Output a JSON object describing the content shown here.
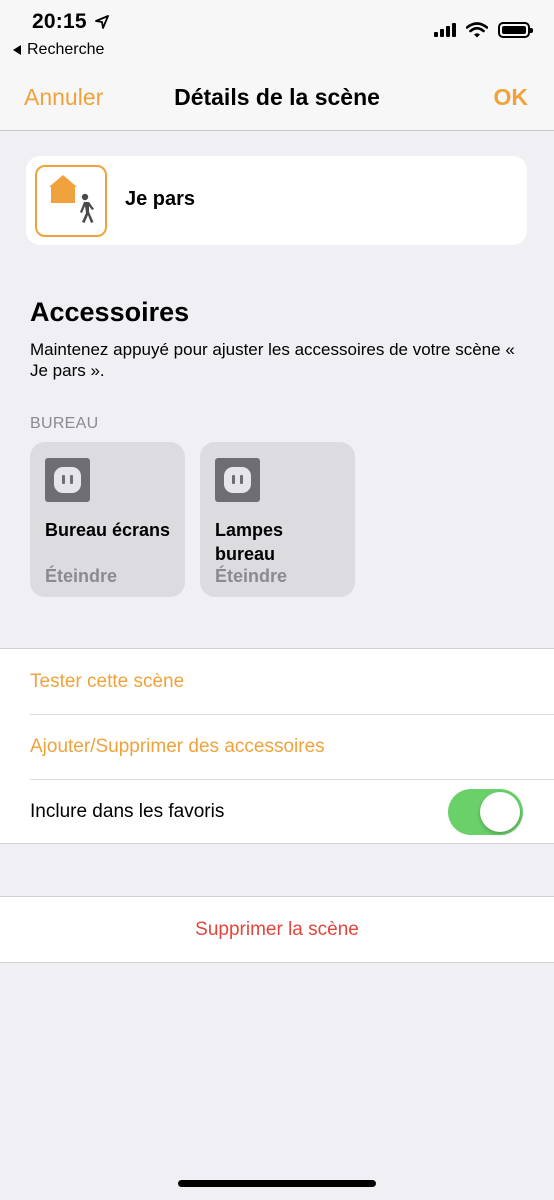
{
  "status": {
    "time": "20:15",
    "back_app": "Recherche"
  },
  "nav": {
    "cancel": "Annuler",
    "title": "Détails de la scène",
    "ok": "OK"
  },
  "scene": {
    "name": "Je pars"
  },
  "accessories": {
    "title": "Accessoires",
    "description": "Maintenez appuyé pour ajuster les accessoires de votre scène « Je pars ».",
    "room": "BUREAU",
    "tiles": [
      {
        "name": "Bureau écrans",
        "status": "Éteindre"
      },
      {
        "name": "Lampes bureau",
        "status": "Éteindre"
      }
    ]
  },
  "actions": {
    "test": "Tester cette scène",
    "edit": "Ajouter/Supprimer des accessoires",
    "favorites": "Inclure dans les favoris",
    "favorites_on": true,
    "delete": "Supprimer la scène"
  },
  "colors": {
    "accent": "#f0a23c",
    "toggle_on": "#6ad16a",
    "destructive": "#e2453c"
  },
  "icons": [
    "location-arrow-icon",
    "back-triangle-icon",
    "cellular-signal-icon",
    "wifi-icon",
    "battery-icon",
    "house-person-icon",
    "outlet-icon"
  ]
}
